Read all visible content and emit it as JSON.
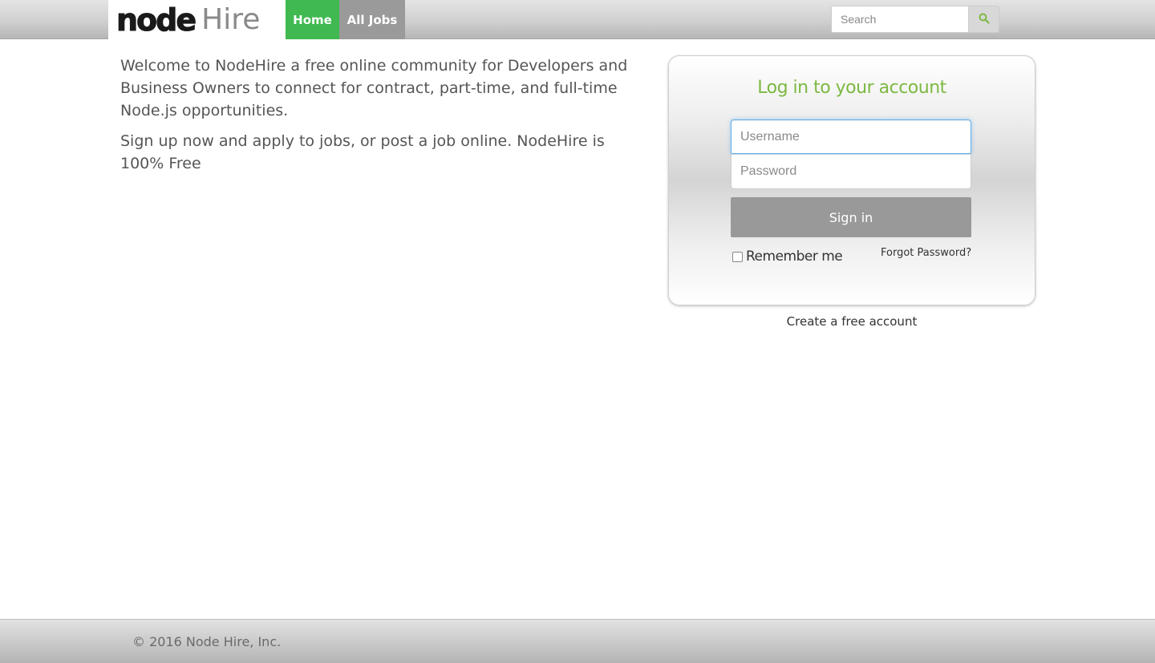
{
  "colors": {
    "accent_green": "#3fb950",
    "title_green": "#7cb842",
    "nav_gray": "#9a9a9a",
    "button_gray": "#999999"
  },
  "navbar": {
    "brand_node": "node",
    "brand_hire": "Hire",
    "items": [
      {
        "label": "Home",
        "active": true
      },
      {
        "label": "All Jobs",
        "active": false
      }
    ],
    "search": {
      "placeholder": "Search",
      "icon": "search-icon"
    }
  },
  "intro": {
    "paragraph_1": "Welcome to NodeHire a free online community for Developers and Business Owners to connect for contract, part-time, and full-time Node.js opportunities.",
    "paragraph_2": "Sign up now and apply to jobs, or post a job online. NodeHire is 100% Free"
  },
  "login": {
    "title": "Log in to your account",
    "username_placeholder": "Username",
    "password_placeholder": "Password",
    "sign_in_label": "Sign in",
    "remember_label": "Remember me",
    "remember_checked": false,
    "forgot_label": "Forgot Password?",
    "create_account_label": "Create a free account"
  },
  "footer": {
    "copyright": "© 2016 Node Hire, Inc."
  }
}
